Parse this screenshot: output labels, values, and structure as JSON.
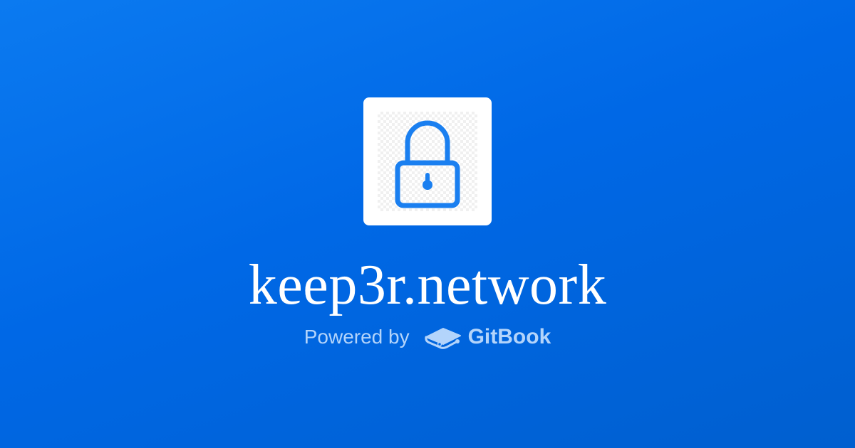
{
  "page": {
    "background_color": "#0070EA"
  },
  "logo": {
    "icon": "lock-icon",
    "color": "#1a7ff0"
  },
  "title": "keep3r.network",
  "footer": {
    "powered_by": "Powered by",
    "brand_icon": "gitbook-icon",
    "brand_name": "GitBook",
    "text_color": "#b3d4fb"
  }
}
